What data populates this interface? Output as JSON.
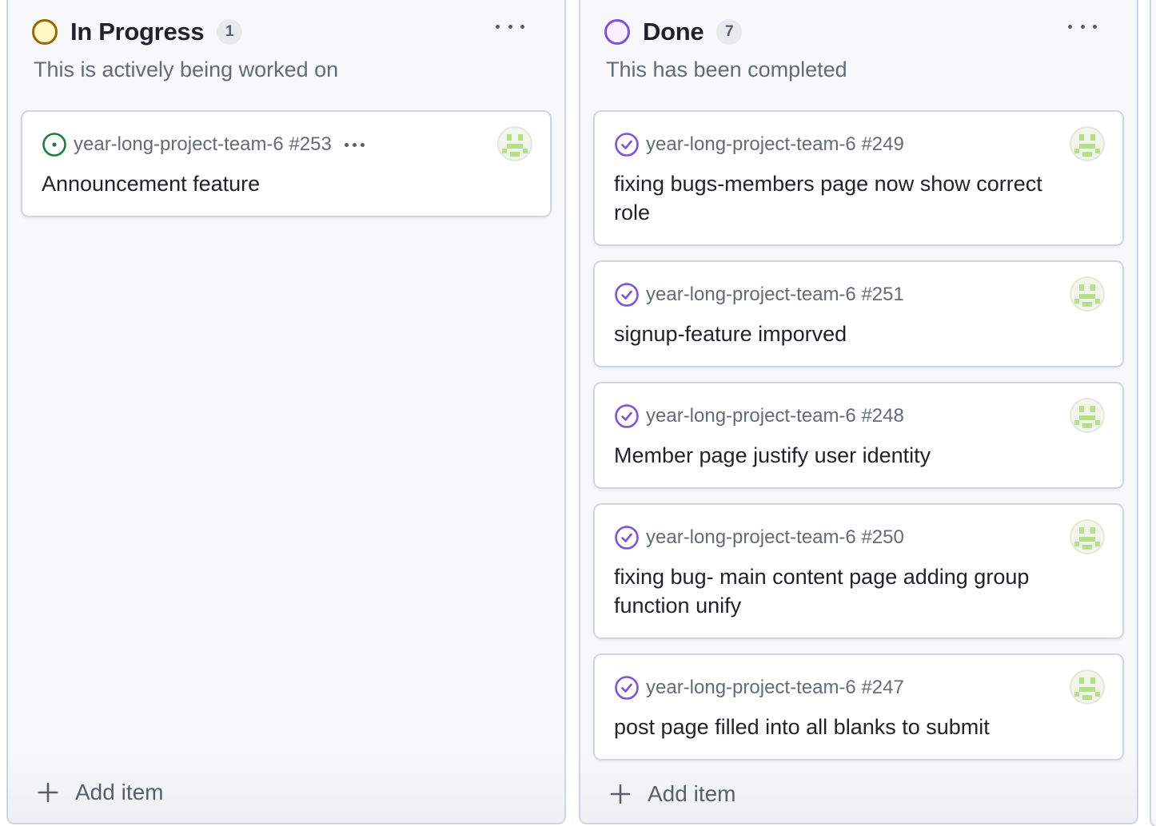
{
  "colors": {
    "in_progress_ring": "#9a6700",
    "in_progress_fill": "#fff8c5",
    "done_ring": "#8250df",
    "done_fill": "#fbefff",
    "open_issue": "#1a7f37",
    "closed_issue": "#8250df",
    "avatar_pattern": "#b4e08a"
  },
  "columns": [
    {
      "title": "In Progress",
      "count": "1",
      "description": "This is actively being worked on",
      "add_item_label": "Add item",
      "menu_icon": "kebab-horizontal-icon",
      "cards": [
        {
          "ref": "year-long-project-team-6 #253",
          "title": "Announcement feature",
          "state": "open",
          "state_icon": "issue-opened-icon",
          "has_menu": true
        }
      ]
    },
    {
      "title": "Done",
      "count": "7",
      "description": "This has been completed",
      "add_item_label": "Add item",
      "menu_icon": "kebab-horizontal-icon",
      "cards": [
        {
          "ref": "year-long-project-team-6 #249",
          "title": "fixing bugs-members page now show correct role",
          "state": "closed",
          "state_icon": "issue-closed-icon"
        },
        {
          "ref": "year-long-project-team-6 #251",
          "title": "signup-feature imporved",
          "state": "closed",
          "state_icon": "issue-closed-icon"
        },
        {
          "ref": "year-long-project-team-6 #248",
          "title": "Member page justify user identity",
          "state": "closed",
          "state_icon": "issue-closed-icon"
        },
        {
          "ref": "year-long-project-team-6 #250",
          "title": "fixing bug- main content page adding group function unify",
          "state": "closed",
          "state_icon": "issue-closed-icon"
        },
        {
          "ref": "year-long-project-team-6 #247",
          "title": "post page filled into all blanks to submit",
          "state": "closed",
          "state_icon": "issue-closed-icon"
        }
      ]
    }
  ]
}
